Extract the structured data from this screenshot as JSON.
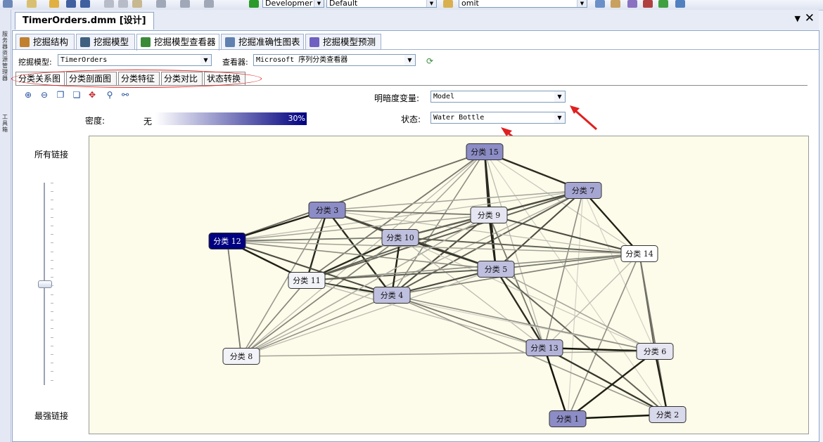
{
  "toolbar": {
    "config_label": "Developmer",
    "platform_label": "Default",
    "find_label": "omit"
  },
  "left_strip": {
    "labels": [
      "服务器资源管理器",
      "工具箱"
    ]
  },
  "document": {
    "tab_title": "TimerOrders.dmm [设计]",
    "pin_glyph": "▼",
    "close_glyph": "✕"
  },
  "main_tabs": [
    {
      "label": "挖掘结构",
      "icon": "structure-icon",
      "color": "#c08030"
    },
    {
      "label": "挖掘模型",
      "icon": "model-icon",
      "color": "#406080"
    },
    {
      "label": "挖掘模型查看器",
      "icon": "viewer-icon",
      "color": "#3a8a3a"
    },
    {
      "label": "挖掘准确性图表",
      "icon": "chart-icon",
      "color": "#6080b0"
    },
    {
      "label": "挖掘模型预测",
      "icon": "diamond-icon",
      "color": "#7060c0"
    }
  ],
  "model_row": {
    "model_label": "挖掘模型:",
    "model_value": "TimerOrders",
    "viewer_label": "查看器:",
    "viewer_value": "Microsoft 序列分类查看器"
  },
  "sub_tabs": [
    "分类关系图",
    "分类剖面图",
    "分类特征",
    "分类对比",
    "状态转换"
  ],
  "shading": {
    "variable_label": "明暗度变量:",
    "variable_value": "Model",
    "state_label": "状态:",
    "state_value": "Water Bottle"
  },
  "density": {
    "label": "密度:",
    "none_label": "无",
    "max_label": "30%",
    "accent": "#000080"
  },
  "link_slider": {
    "top_label": "所有链接",
    "bottom_label": "最强链接",
    "position": 0.5
  },
  "graph": {
    "nodes": [
      {
        "label": "分类 15",
        "density": 0.45
      },
      {
        "label": "分类 7",
        "density": 0.35
      },
      {
        "label": "分类 3",
        "density": 0.45
      },
      {
        "label": "分类 9",
        "density": 0.1
      },
      {
        "label": "分类 10",
        "density": 0.25
      },
      {
        "label": "分类 12",
        "density": 1.0
      },
      {
        "label": "分类 14",
        "density": 0.0
      },
      {
        "label": "分类 5",
        "density": 0.25
      },
      {
        "label": "分类 11",
        "density": 0.05
      },
      {
        "label": "分类 4",
        "density": 0.25
      },
      {
        "label": "分类 13",
        "density": 0.3
      },
      {
        "label": "分类 6",
        "density": 0.1
      },
      {
        "label": "分类 8",
        "density": 0.05
      },
      {
        "label": "分类 2",
        "density": 0.15
      },
      {
        "label": "分类 1",
        "density": 0.45
      }
    ],
    "edges": [
      [
        "分类 15",
        "分类 12",
        0.55
      ],
      [
        "分类 15",
        "分类 11",
        0.5
      ],
      [
        "分类 15",
        "分类 4",
        0.4
      ],
      [
        "分类 15",
        "分类 9",
        0.85
      ],
      [
        "分类 15",
        "分类 5",
        0.85
      ],
      [
        "分类 15",
        "分类 7",
        0.85
      ],
      [
        "分类 15",
        "分类 8",
        0.2
      ],
      [
        "分类 15",
        "分类 14",
        0.15
      ],
      [
        "分类 15",
        "分类 13",
        0.2
      ],
      [
        "分类 15",
        "分类 10",
        0.3
      ],
      [
        "分类 15",
        "分类 2",
        0.1
      ],
      [
        "分类 7",
        "分类 3",
        0.3
      ],
      [
        "分类 7",
        "分类 9",
        0.7
      ],
      [
        "分类 7",
        "分类 10",
        0.7
      ],
      [
        "分类 7",
        "分类 11",
        0.6
      ],
      [
        "分类 7",
        "分类 4",
        0.6
      ],
      [
        "分类 7",
        "分类 14",
        0.9
      ],
      [
        "分类 7",
        "分类 5",
        0.7
      ],
      [
        "分类 7",
        "分类 13",
        0.4
      ],
      [
        "分类 7",
        "分类 12",
        0.2
      ],
      [
        "分类 7",
        "分类 6",
        0.1
      ],
      [
        "分类 7",
        "分类 8",
        0.25
      ],
      [
        "分类 7",
        "分类 1",
        0.1
      ],
      [
        "分类 3",
        "分类 12",
        0.9
      ],
      [
        "分类 3",
        "分类 10",
        0.7
      ],
      [
        "分类 3",
        "分类 9",
        0.5
      ],
      [
        "分类 3",
        "分类 5",
        0.7
      ],
      [
        "分类 3",
        "分类 11",
        0.85
      ],
      [
        "分类 3",
        "分类 4",
        0.85
      ],
      [
        "分类 3",
        "分类 8",
        0.35
      ],
      [
        "分类 3",
        "分类 14",
        0.2
      ],
      [
        "分类 9",
        "分类 12",
        0.3
      ],
      [
        "分类 9",
        "分类 10",
        0.6
      ],
      [
        "分类 9",
        "分类 11",
        0.6
      ],
      [
        "分类 9",
        "分类 4",
        0.7
      ],
      [
        "分类 9",
        "分类 5",
        0.9
      ],
      [
        "分类 9",
        "分类 14",
        0.7
      ],
      [
        "分类 9",
        "分类 13",
        0.5
      ],
      [
        "分类 9",
        "分类 8",
        0.3
      ],
      [
        "分类 10",
        "分类 12",
        0.5
      ],
      [
        "分类 10",
        "分类 11",
        0.85
      ],
      [
        "分类 10",
        "分类 4",
        0.9
      ],
      [
        "分类 10",
        "分类 5",
        0.8
      ],
      [
        "分类 10",
        "分类 14",
        0.6
      ],
      [
        "分类 10",
        "分类 8",
        0.45
      ],
      [
        "分类 10",
        "分类 6",
        0.15
      ],
      [
        "分类 10",
        "分类 13",
        0.2
      ],
      [
        "分类 12",
        "分类 11",
        0.9
      ],
      [
        "分类 12",
        "分类 4",
        0.7
      ],
      [
        "分类 12",
        "分类 8",
        0.5
      ],
      [
        "分类 12",
        "分类 14",
        0.3
      ],
      [
        "分类 14",
        "分类 5",
        0.5
      ],
      [
        "分类 14",
        "分类 11",
        0.4
      ],
      [
        "分类 14",
        "分类 4",
        0.45
      ],
      [
        "分类 14",
        "分类 6",
        0.6
      ],
      [
        "分类 14",
        "分类 2",
        0.5
      ],
      [
        "分类 14",
        "分类 1",
        0.4
      ],
      [
        "分类 14",
        "分类 13",
        0.2
      ],
      [
        "分类 5",
        "分类 11",
        0.6
      ],
      [
        "分类 5",
        "分类 4",
        0.7
      ],
      [
        "分类 5",
        "分类 13",
        0.85
      ],
      [
        "分类 5",
        "分类 2",
        0.6
      ],
      [
        "分类 5",
        "分类 6",
        0.3
      ],
      [
        "分类 5",
        "分类 8",
        0.2
      ],
      [
        "分类 11",
        "分类 4",
        0.85
      ],
      [
        "分类 11",
        "分类 8",
        0.45
      ],
      [
        "分类 11",
        "分类 6",
        0.1
      ],
      [
        "分类 11",
        "分类 13",
        0.2
      ],
      [
        "分类 4",
        "分类 8",
        0.4
      ],
      [
        "分类 4",
        "分类 13",
        0.5
      ],
      [
        "分类 4",
        "分类 6",
        0.4
      ],
      [
        "分类 4",
        "分类 2",
        0.35
      ],
      [
        "分类 13",
        "分类 6",
        0.95
      ],
      [
        "分类 13",
        "分类 1",
        0.95
      ],
      [
        "分类 13",
        "分类 2",
        0.8
      ],
      [
        "分类 6",
        "分类 2",
        0.9
      ],
      [
        "分类 6",
        "分类 1",
        0.9
      ],
      [
        "分类 2",
        "分类 1",
        0.95
      ],
      [
        "分类 8",
        "分类 6",
        0.3
      ],
      [
        "分类 8",
        "分类 9",
        0.25
      ],
      [
        "分类 12",
        "分类 5",
        0.4
      ]
    ]
  }
}
